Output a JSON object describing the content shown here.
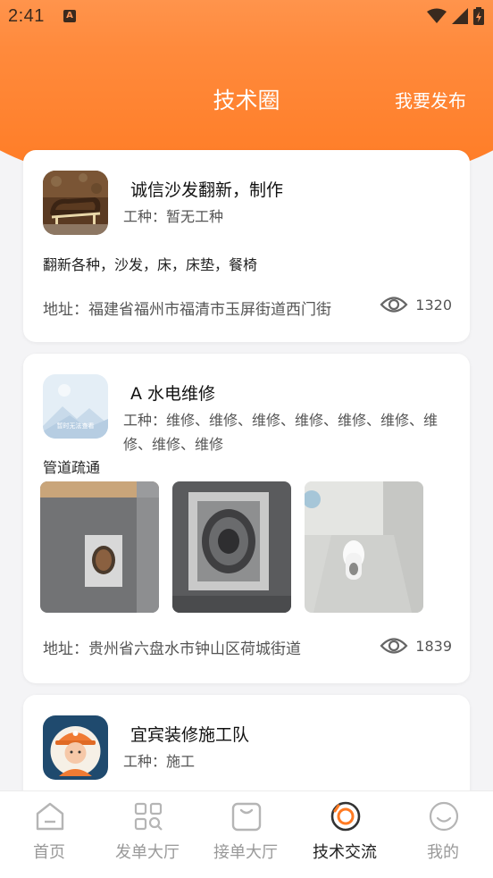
{
  "status_bar": {
    "time": "2:41",
    "notif_icon": "A"
  },
  "nav": {
    "title": "技术圈",
    "publish": "我要发布"
  },
  "cards": [
    {
      "name": "诚信沙发翻新，制作",
      "type": "工种：暂无工种",
      "desc": "翻新各种，沙发，床，床垫，餐椅",
      "address": "地址：福建省福州市福清市玉屏街道西门街",
      "views": "1320",
      "avatar": "sofa-photo"
    },
    {
      "name": "A 水电维修",
      "type": "工种：维修、维修、维修、维修、维修、维修、维修、维修、维修",
      "desc": "管道疏通",
      "address": "地址：贵州省六盘水市钟山区荷城街道",
      "views": "1839",
      "avatar": "placeholder-image",
      "avatar_caption": "暂时无法查看",
      "photos": [
        "floor-drain-photo",
        "drain-cover-photo",
        "squat-toilet-photo"
      ]
    },
    {
      "name": "宜宾装修施工队",
      "type": "工种：施工",
      "avatar": "worker-avatar"
    }
  ],
  "tabbar": [
    {
      "label": "首页",
      "icon": "home-icon",
      "active": false
    },
    {
      "label": "发单大厅",
      "icon": "grid-search-icon",
      "active": false
    },
    {
      "label": "接单大厅",
      "icon": "bag-icon",
      "active": false
    },
    {
      "label": "技术交流",
      "icon": "tech-circle-icon",
      "active": true
    },
    {
      "label": "我的",
      "icon": "smile-icon",
      "active": false
    }
  ],
  "colors": {
    "accent": "#ff7a22",
    "header_top": "#ffa263"
  }
}
